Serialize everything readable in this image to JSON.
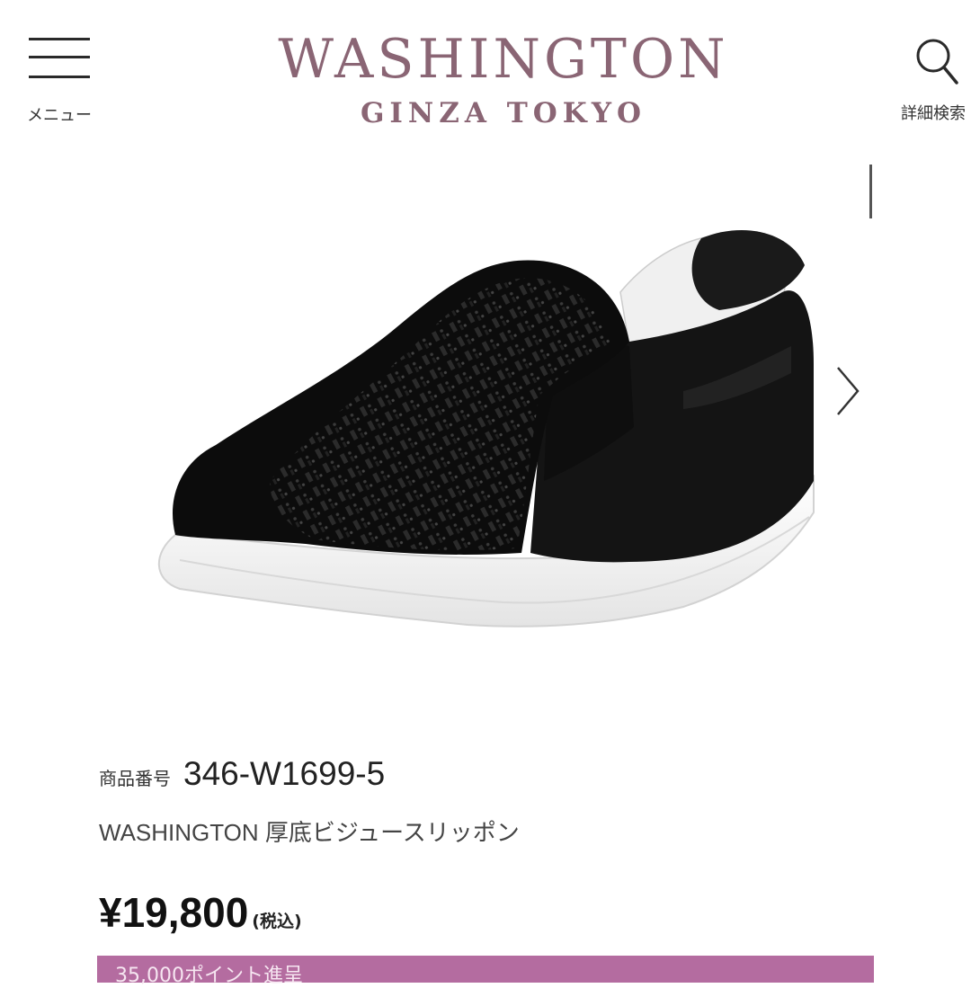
{
  "header": {
    "menu_label": "メニュー",
    "logo_main": "WASHINGTON",
    "logo_sub": "GINZA TOKYO",
    "search_label": "詳細検索"
  },
  "carousel": {
    "image_alt": "black wedge slip-on sneaker with bijou rhinestones",
    "next_icon": "chevron-right-icon"
  },
  "product": {
    "code_label": "商品番号",
    "code": "346-W1699-5",
    "name": "WASHINGTON 厚底ビジュースリッポン",
    "price": "¥19,800",
    "tax_note": "(税込)"
  },
  "points": {
    "text": "35,000ポイント進呈"
  },
  "colors": {
    "brand": "#8a6574",
    "points_banner": "#b46ca0"
  }
}
